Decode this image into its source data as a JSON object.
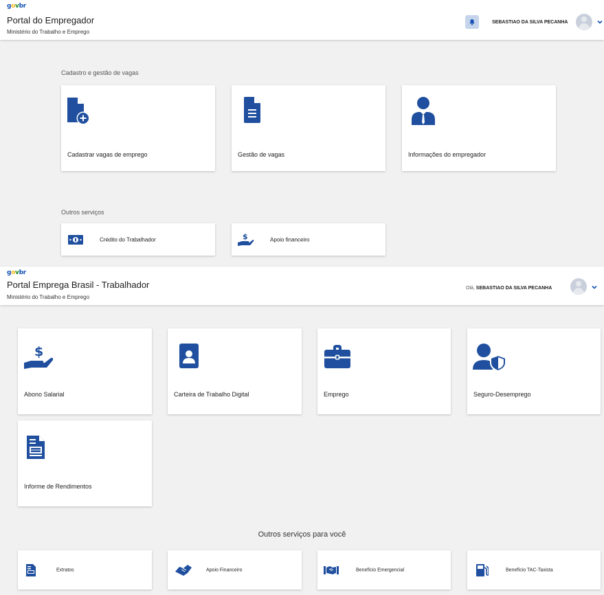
{
  "top": {
    "brand": {
      "g": "g",
      "o": "o",
      "v": "v",
      "b": "br"
    },
    "title": "Portal do Empregador",
    "ministry": "Ministério do Trabalho e Emprego",
    "user_name": "SEBASTIAO DA SILVA PECANHA",
    "section1_title": "Cadastro e gestão de vagas",
    "cards": [
      {
        "label": "Cadastrar vagas de emprego",
        "icon": "add-document-icon"
      },
      {
        "label": "Gestão de vagas",
        "icon": "document-icon"
      },
      {
        "label": "Informações do empregador",
        "icon": "employer-icon"
      }
    ],
    "section2_title": "Outros serviços",
    "services": [
      {
        "label": "Crédito do Trabalhador",
        "icon": "money-icon"
      },
      {
        "label": "Apoio financeiro",
        "icon": "hand-money-icon"
      }
    ]
  },
  "bottom": {
    "brand": {
      "g": "g",
      "o": "o",
      "v": "v",
      "b": "br"
    },
    "title": "Portal Emprega Brasil - Trabalhador",
    "ministry": "Ministério do Trabalho e Emprego",
    "greeting": "Olá,",
    "user_name": "SEBASTIAO DA SILVA PECANHA",
    "cards": [
      {
        "label": "Abono Salarial",
        "icon": "hand-money-icon"
      },
      {
        "label": "Carteira de Trabalho Digital",
        "icon": "id-card-icon"
      },
      {
        "label": "Emprego",
        "icon": "briefcase-icon"
      },
      {
        "label": "Seguro-Desemprego",
        "icon": "user-shield-icon"
      },
      {
        "label": "Informe de Rendimentos",
        "icon": "report-icon"
      }
    ],
    "other_title": "Outros serviços para você",
    "services": [
      {
        "label": "Extratos",
        "icon": "statement-icon"
      },
      {
        "label": "Apoio Financeiro",
        "icon": "handshake-icon"
      },
      {
        "label": "Benefício Emergencial",
        "icon": "emergency-handshake-icon"
      },
      {
        "label": "Benefício TAC-Taxista",
        "icon": "fuel-icon"
      }
    ]
  },
  "colors": {
    "accent": "#1351b4",
    "icon_blue": "#1f4f9e",
    "background": "#f1f1f1"
  }
}
